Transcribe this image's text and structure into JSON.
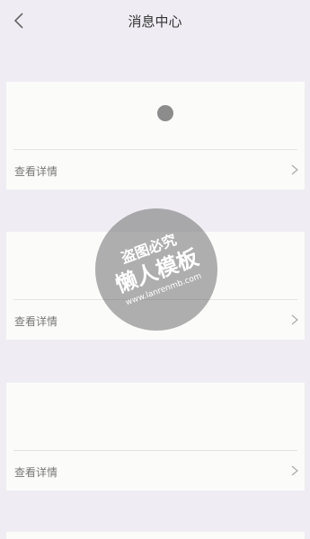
{
  "header": {
    "title": "消息中心",
    "back_icon": "chevron-left-icon"
  },
  "cards": [
    {
      "detail_label": "查看详情",
      "chevron_icon": "chevron-right-icon"
    },
    {
      "detail_label": "查看详情",
      "chevron_icon": "chevron-right-icon"
    },
    {
      "detail_label": "查看详情",
      "chevron_icon": "chevron-right-icon"
    }
  ],
  "watermark": {
    "line1": "盗图必究",
    "line2": "懒人模板",
    "url": "www.lanrenmb.com"
  },
  "colors": {
    "background": "#efedf3",
    "card": "#fbfcfa",
    "divider": "#e3e3e3",
    "loading_dot": "#8c8c8c"
  }
}
